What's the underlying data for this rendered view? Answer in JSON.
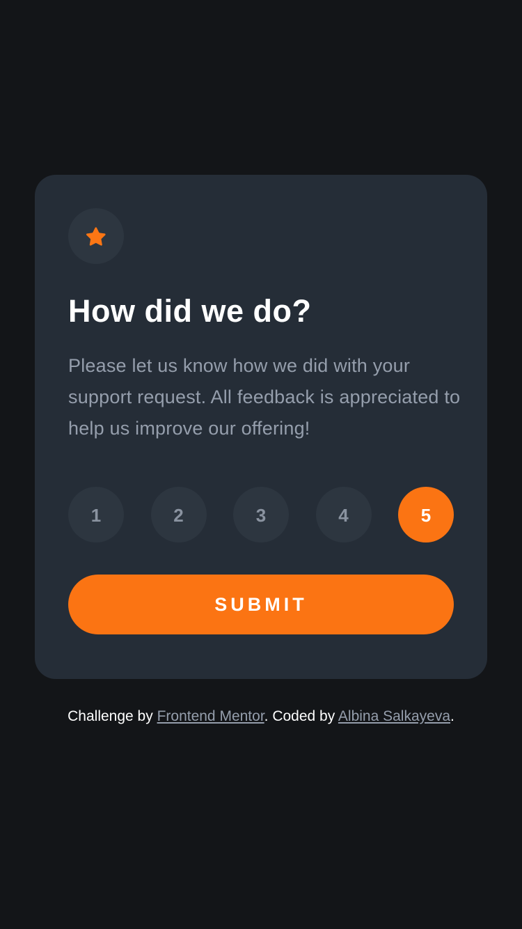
{
  "card": {
    "icon": "star-icon",
    "title": "How did we do?",
    "description": "Please let us know how we did with your support request. All feedback is appreciated to help us improve our offering!",
    "ratings": [
      "1",
      "2",
      "3",
      "4",
      "5"
    ],
    "selected_rating": "5",
    "submit_label": "SUBMIT"
  },
  "attribution": {
    "prefix": "Challenge by ",
    "link1": "Frontend Mentor",
    "middle": ". Coded by ",
    "link2": "Albina Salkayeva",
    "suffix": "."
  },
  "colors": {
    "page_background": "#131518",
    "card_background": "#252d37",
    "accent": "#fb7413",
    "muted_text": "#959eac",
    "circle_background": "#2d3640"
  }
}
